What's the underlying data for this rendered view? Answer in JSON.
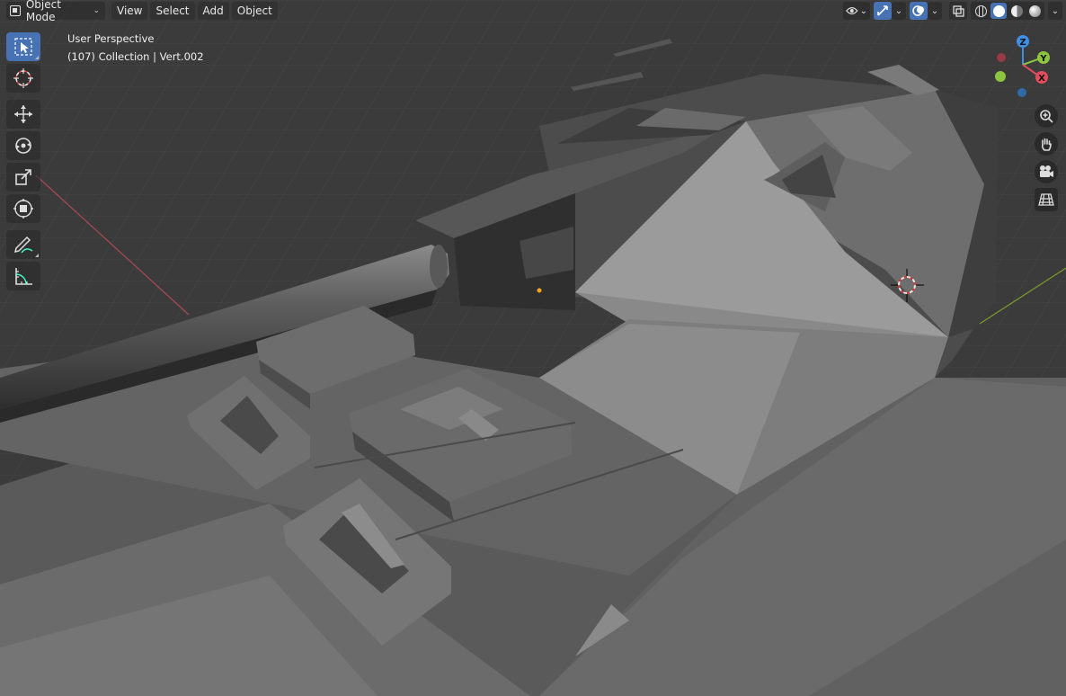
{
  "header": {
    "mode_label": "Object Mode",
    "menus": [
      "View",
      "Select",
      "Add",
      "Object"
    ]
  },
  "overlay": {
    "perspective_label": "User Perspective",
    "collection_label": "(107) Collection | Vert.002"
  },
  "gizmo": {
    "z_label": "Z",
    "y_label": "Y",
    "x_label": "X"
  },
  "colors": {
    "accent": "#4772b3",
    "x_axis": "#e24c5c",
    "y_axis": "#8cc63f",
    "z_axis": "#3f8fe6"
  },
  "tools": [
    "select-box-icon",
    "cursor-icon",
    "move-icon",
    "rotate-icon",
    "scale-icon",
    "transform-icon",
    "annotate-icon",
    "measure-icon"
  ]
}
